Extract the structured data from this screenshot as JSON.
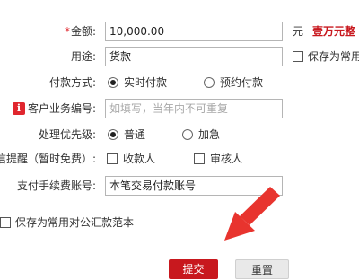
{
  "form": {
    "amount": {
      "label": "金额:",
      "value": "10,000.00",
      "unit": "元",
      "capital": "壹万元整"
    },
    "purpose": {
      "label": "用途:",
      "value": "货款",
      "save_common": "保存为常用"
    },
    "payment_mode": {
      "label": "付款方式:",
      "options": [
        "实时付款",
        "预约付款"
      ],
      "selected": "实时付款"
    },
    "customer_no": {
      "label": "客户业务编号:",
      "placeholder": "如填写，当年内不可重复"
    },
    "priority": {
      "label": "处理优先级:",
      "options": [
        "普通",
        "加急"
      ],
      "selected": "普通"
    },
    "sms_notify": {
      "label": "信提醒（暂时免费）:",
      "options": [
        "收款人",
        "审核人"
      ]
    },
    "fee_account": {
      "label": "支付手续费账号:",
      "value": "本笔交易付款账号"
    },
    "save_template": "保存为常用对公汇款范本"
  },
  "buttons": {
    "submit": "提交",
    "reset": "重置"
  },
  "colors": {
    "accent": "#c8181e",
    "arrow": "#e8342e",
    "required": "#e0262e"
  },
  "icons": {
    "info": "info-icon",
    "arrow": "red-arrow-annotation"
  }
}
